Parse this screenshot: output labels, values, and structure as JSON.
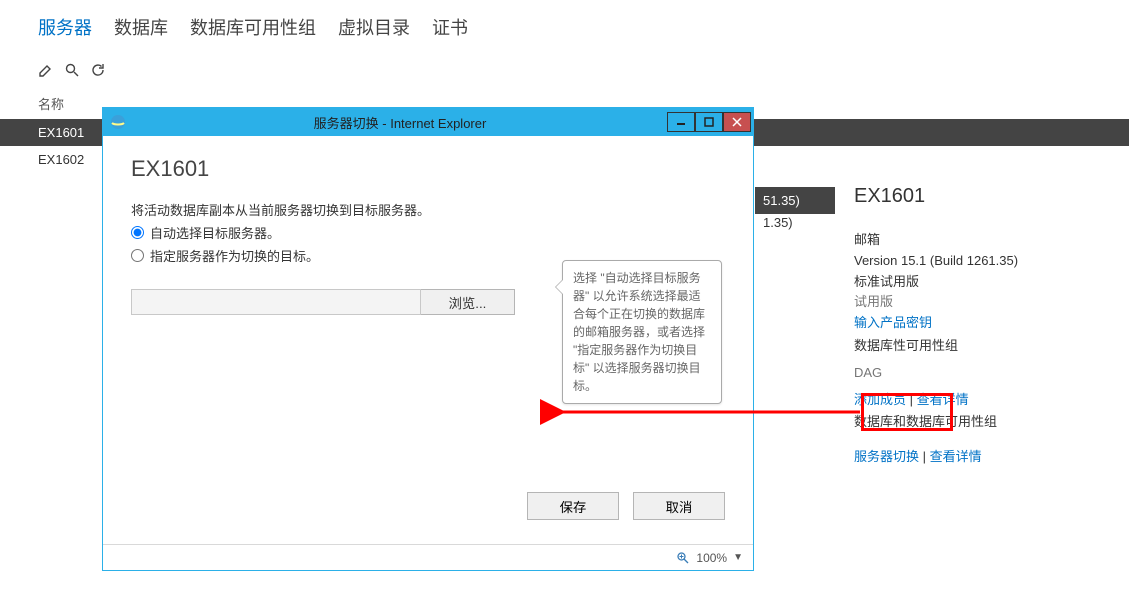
{
  "tabs": {
    "servers": "服务器",
    "databases": "数据库",
    "dag": "数据库可用性组",
    "vdirs": "虚拟目录",
    "certs": "证书"
  },
  "toolbar": {},
  "list": {
    "nameHeader": "名称",
    "rows": [
      {
        "name": "EX1601",
        "extra": "51.35)"
      },
      {
        "name": "EX1602",
        "extra": "1.35)"
      }
    ]
  },
  "detail": {
    "title": "EX1601",
    "mailbox": "邮箱",
    "version": "Version 15.1 (Build 1261.35)",
    "edition": "标准试用版",
    "trial": "试用版",
    "enterKey": "输入产品密钥",
    "dagHeading": "数据库性可用性组",
    "dagName": "DAG",
    "addMember": "添加成员",
    "viewDetails": "查看详情",
    "dbAndDag": "数据库和数据库可用性组",
    "switchover": "服务器切换",
    "viewDetails2": "查看详情"
  },
  "dialog": {
    "windowTitle": "服务器切换 - Internet Explorer",
    "heading": "EX1601",
    "intro": "将活动数据库副本从当前服务器切换到目标服务器。",
    "optAuto": "自动选择目标服务器。",
    "optSpecify": "指定服务器作为切换的目标。",
    "browse": "浏览...",
    "save": "保存",
    "cancel": "取消",
    "zoom": "100%",
    "callout": "选择 \"自动选择目标服务器\" 以允许系统选择最适合每个正在切换的数据库的邮箱服务器，或者选择 \"指定服务器作为切换目标\" 以选择服务器切换目标。"
  }
}
